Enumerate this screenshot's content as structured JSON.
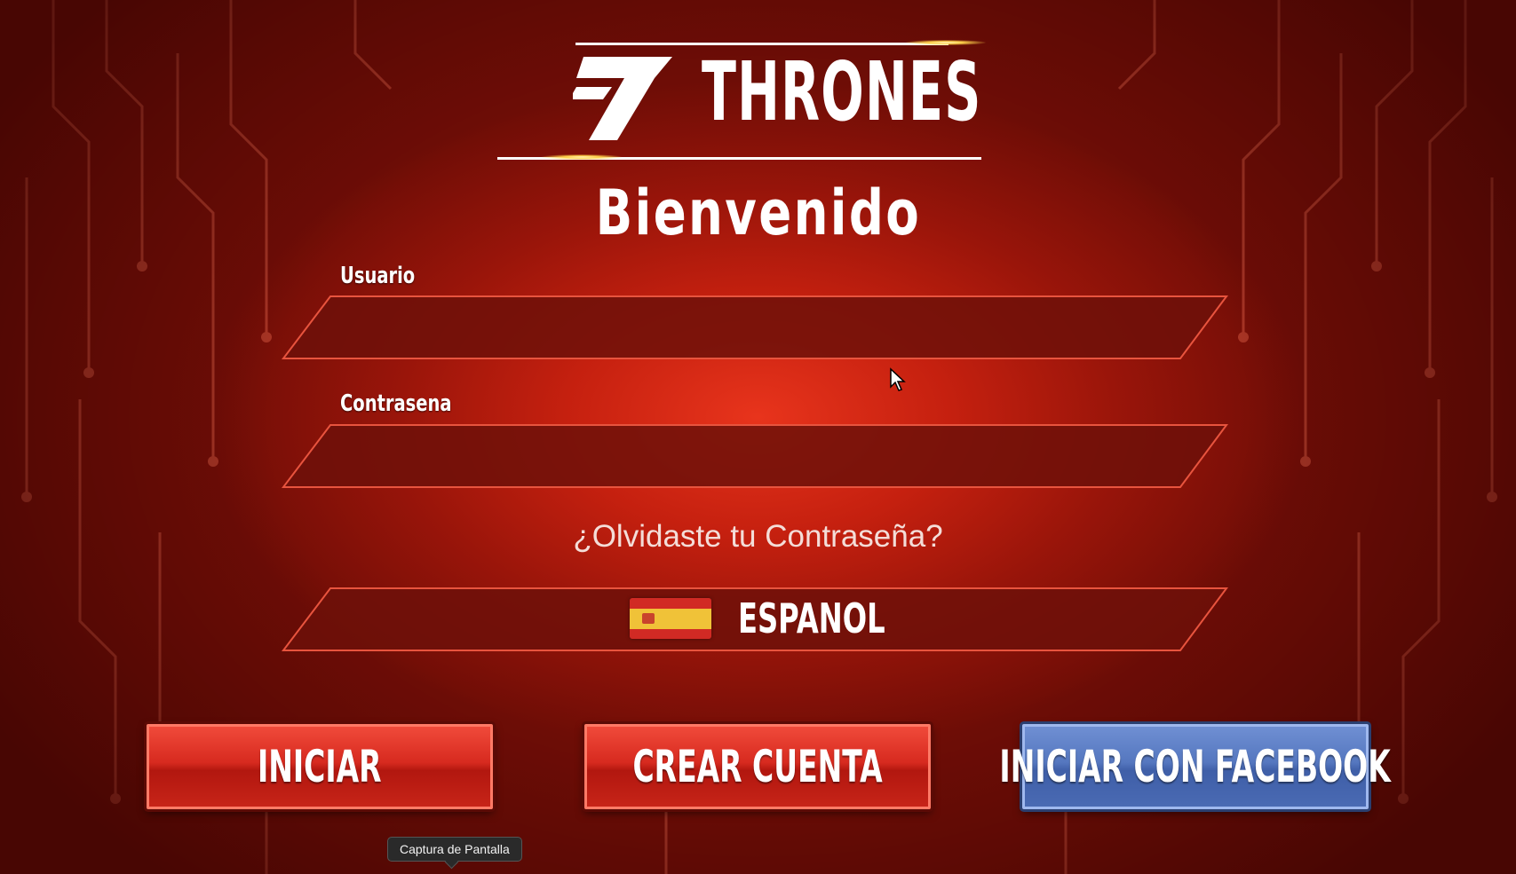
{
  "logo": {
    "number": "7",
    "name": "THRONES"
  },
  "welcome": "Bienvenido",
  "form": {
    "username_label": "Usuario",
    "username_value": "",
    "password_label": "Contrasena",
    "password_value": ""
  },
  "forgot_password": "¿Olvidaste tu Contraseña?",
  "language": {
    "label": "ESPANOL",
    "flag_icon": "spain-flag-icon"
  },
  "buttons": {
    "login": "INICIAR",
    "create_account": "CREAR CUENTA",
    "facebook_login": "INICIAR CON FACEBOOK"
  },
  "tooltip": "Captura de Pantalla",
  "colors": {
    "background_red": "#c5200f",
    "button_red": "#d72a1f",
    "button_blue": "#5577bf"
  }
}
